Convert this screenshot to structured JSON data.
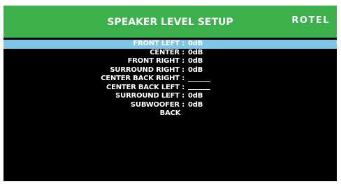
{
  "header": {
    "title": "SPEAKER LEVEL SETUP",
    "brand": "ROTEL",
    "color": "#3cb04a"
  },
  "menu": {
    "selected_color": "#7fc5e8",
    "items": [
      {
        "label": "FRONT LEFT :",
        "value": "0dB",
        "selected": true
      },
      {
        "label": "CENTER :",
        "value": "0dB"
      },
      {
        "label": "FRONT RIGHT :",
        "value": "0dB"
      },
      {
        "label": "SURROUND RIGHT :",
        "value": "0dB"
      },
      {
        "label": "CENTER BACK RIGHT :",
        "value": ""
      },
      {
        "label": "CENTER BACK LEFT :",
        "value": ""
      },
      {
        "label": "SURROUND LEFT :",
        "value": "0dB"
      },
      {
        "label": "SUBWOOFER :",
        "value": "0dB"
      }
    ],
    "back_label": "BACK"
  }
}
